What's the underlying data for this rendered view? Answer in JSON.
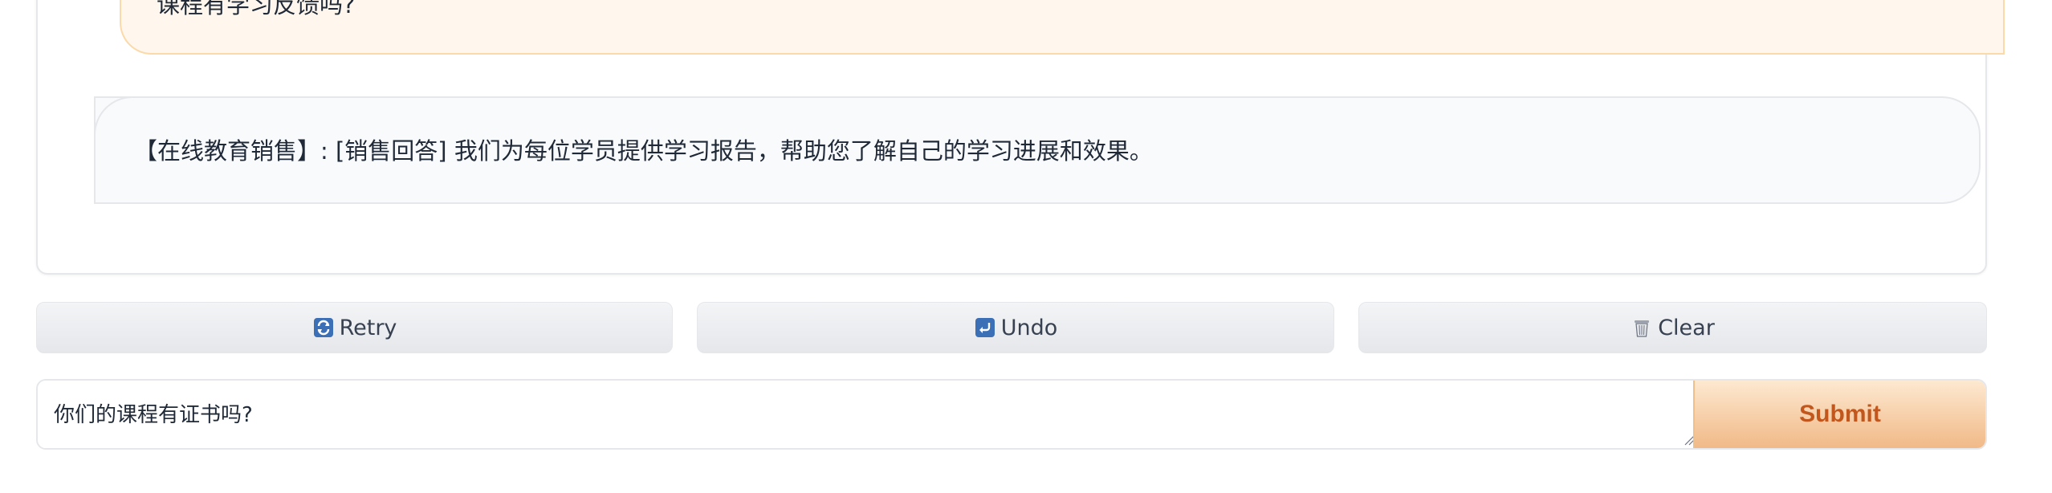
{
  "chat": {
    "messages": [
      {
        "role": "user",
        "text": "课程有学习反馈吗?"
      },
      {
        "role": "bot",
        "text": "【在线教育销售】:  [销售回答] 我们为每位学员提供学习报告，帮助您了解自己的学习进展和效果。"
      }
    ]
  },
  "actions": {
    "retry": {
      "label": "Retry",
      "icon": "retry-icon"
    },
    "undo": {
      "label": "Undo",
      "icon": "undo-icon"
    },
    "clear": {
      "label": "Clear",
      "icon": "trash-icon"
    }
  },
  "input": {
    "value": "你们的课程有证书吗?",
    "submit_label": "Submit"
  },
  "colors": {
    "user_bubble_bg": "#fff7ed",
    "user_bubble_border": "#fcd9a8",
    "submit_text": "#c2571d",
    "icon_blue": "#3b6fb6"
  }
}
